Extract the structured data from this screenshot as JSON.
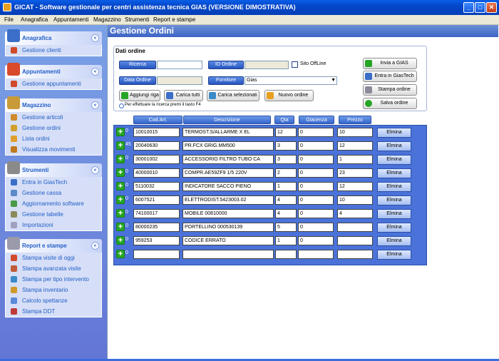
{
  "window": {
    "title": "GICAT - Software gestionale per centri assistenza tecnica GIAS (VERSIONE DIMOSTRATIVA)",
    "min": "_",
    "max": "□",
    "close": "✕"
  },
  "menu": [
    "File",
    "Anagrafica",
    "Appuntamenti",
    "Magazzino",
    "Strumenti",
    "Report e stampe"
  ],
  "sidebar": {
    "anagrafica": {
      "title": "Anagrafica",
      "items": [
        "Gestione clienti"
      ]
    },
    "appuntamenti": {
      "title": "Appuntamenti",
      "items": [
        "Gestione appuntamenti"
      ]
    },
    "magazzino": {
      "title": "Magazzino",
      "items": [
        "Gestione articoli",
        "Gestione ordini",
        "Lista ordini",
        "Visualizza movimenti"
      ]
    },
    "strumenti": {
      "title": "Strumenti",
      "items": [
        "Entra in GiasTech",
        "Gestione cassa",
        "Aggiornamento software",
        "Gestione tabelle",
        "Importazioni"
      ]
    },
    "report": {
      "title": "Report e stampe",
      "items": [
        "Stampa visite di oggi",
        "Stampa avanzata visite",
        "Stampa per tipo intervento",
        "Stampa inventario",
        "Calcolo spettanze",
        "Stampa DDT"
      ]
    }
  },
  "main": {
    "title": "Gestione Ordini",
    "section_title": "Dati ordine",
    "labels": {
      "ricerca": "Ricerca",
      "id_ordine": "ID Ordine",
      "data_ordine": "Data Ordine",
      "fornitore": "Fornitore",
      "sito_offline": "Sito OffLine"
    },
    "fields": {
      "ricerca": "",
      "id_ordine": "",
      "data_ordine": "",
      "fornitore": "Gias"
    },
    "buttons": {
      "aggiungi_riga": "Aggiungi riga",
      "carica_tutti": "Carica tutti",
      "carica_selezionati": "Carica selezionati",
      "nuovo_ordine": "Nuovo ordine",
      "invia_gias": "Invia a GIAS",
      "entra_giastech": "Entra in GiasTech",
      "stampa_ordine": "Stampa ordine",
      "salva_ordine": "Salva ordine"
    },
    "hint": "Per effettuare la ricerca premi il tasto F4",
    "columns": [
      "Cod.Art.",
      "Descrizione",
      "Qta",
      "Giacenza",
      "Prezzo"
    ],
    "elimina_label": "Elmina",
    "rows": [
      {
        "n": "0",
        "cod": "10010015",
        "desc": "TERMOST.S/ALLARME X EL",
        "qta": "12",
        "giac": "0",
        "prezzo": "10"
      },
      {
        "n": "45",
        "cod": "20040630",
        "desc": "PR.FCX GRIG.MM500",
        "qta": "3",
        "giac": "0",
        "prezzo": "12"
      },
      {
        "n": "0",
        "cod": "30001002",
        "desc": "ACCESSORIO FILTRO TUBO CA",
        "qta": "3",
        "giac": "0",
        "prezzo": "1"
      },
      {
        "n": "0",
        "cod": "40000010",
        "desc": "COMPR.AE59ZF9 1/5 220V",
        "qta": "2",
        "giac": "0",
        "prezzo": "23"
      },
      {
        "n": "0",
        "cod": "5110032",
        "desc": "INDICATORE SACCO PIENO",
        "qta": "1",
        "giac": "0",
        "prezzo": "12"
      },
      {
        "n": "0",
        "cod": "6007521",
        "desc": "ELETTRODIST.5423003.02",
        "qta": "4",
        "giac": "0",
        "prezzo": "10"
      },
      {
        "n": "0",
        "cod": "74100017",
        "desc": "MOBILE 00810000",
        "qta": "4",
        "giac": "0",
        "prezzo": "4"
      },
      {
        "n": "0",
        "cod": "80000235",
        "desc": "PORTELLINO 000530139",
        "qta": "5",
        "giac": "0",
        "prezzo": ""
      },
      {
        "n": "0",
        "cod": "959253",
        "desc": "CODICE ERRATO",
        "qta": "1",
        "giac": "0",
        "prezzo": ""
      },
      {
        "n": "0",
        "cod": "",
        "desc": "",
        "qta": "",
        "giac": "",
        "prezzo": ""
      }
    ]
  }
}
